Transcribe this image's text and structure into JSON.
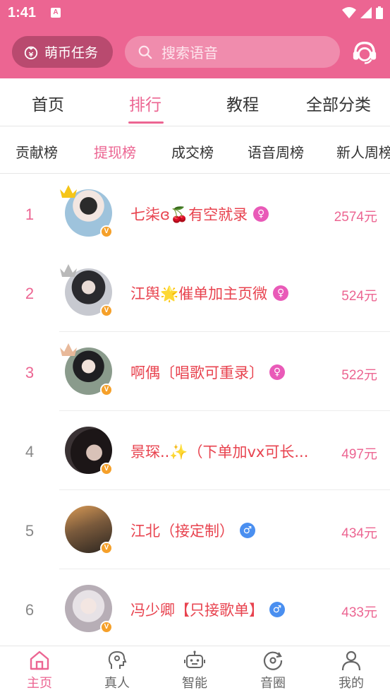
{
  "status_bar": {
    "time": "1:41",
    "notification_icon": "A"
  },
  "header": {
    "coin_task_label": "萌币任务",
    "search_placeholder": "搜索语音",
    "icons": [
      "coin-bag-icon",
      "search-icon",
      "customer-service-icon"
    ]
  },
  "tabs": [
    {
      "label": "首页",
      "active": false
    },
    {
      "label": "排行",
      "active": true
    },
    {
      "label": "教程",
      "active": false
    },
    {
      "label": "全部分类",
      "active": false
    }
  ],
  "subtabs": [
    {
      "label": "贡献榜",
      "active": false
    },
    {
      "label": "提现榜",
      "active": true
    },
    {
      "label": "成交榜",
      "active": false
    },
    {
      "label": "语音周榜",
      "active": false
    },
    {
      "label": "新人周榜",
      "active": false
    }
  ],
  "ranking": [
    {
      "rank": "1",
      "name": "七柒ɞ🍒有空就录",
      "gender": "♀",
      "amount": "2574元",
      "crown": "gold",
      "avatar_color": "#9ec3dc"
    },
    {
      "rank": "2",
      "name": "江舆🌟催单加主页微",
      "gender": "♀",
      "amount": "524元",
      "crown": "silver",
      "avatar_color": "#6d6f78"
    },
    {
      "rank": "3",
      "name": "啊偶〔唱歌可重录〕",
      "gender": "♀",
      "amount": "522元",
      "crown": "bronze",
      "avatar_color": "#8a9b8c"
    },
    {
      "rank": "4",
      "name": "景琛..✨（下单加vx可长...",
      "gender": "",
      "amount": "497元",
      "crown": "",
      "avatar_color": "#3a3234"
    },
    {
      "rank": "5",
      "name": "江北（接定制）",
      "gender": "♂",
      "amount": "434元",
      "crown": "",
      "avatar_color": "#7a5a3c"
    },
    {
      "rank": "6",
      "name": "冯少卿【只接歌单】",
      "gender": "♂",
      "amount": "433元",
      "crown": "",
      "avatar_color": "#c9c3c8"
    }
  ],
  "bottom_nav": [
    {
      "label": "主页",
      "icon": "home-icon",
      "active": true
    },
    {
      "label": "真人",
      "icon": "person-voice-icon",
      "active": false
    },
    {
      "label": "智能",
      "icon": "robot-icon",
      "active": false
    },
    {
      "label": "音圈",
      "icon": "music-circle-icon",
      "active": false
    },
    {
      "label": "我的",
      "icon": "profile-icon",
      "active": false
    }
  ],
  "colors": {
    "brand": "#ec6592",
    "name_red": "#e8434f",
    "female": "#e95ab8",
    "male": "#4a8ff0"
  }
}
